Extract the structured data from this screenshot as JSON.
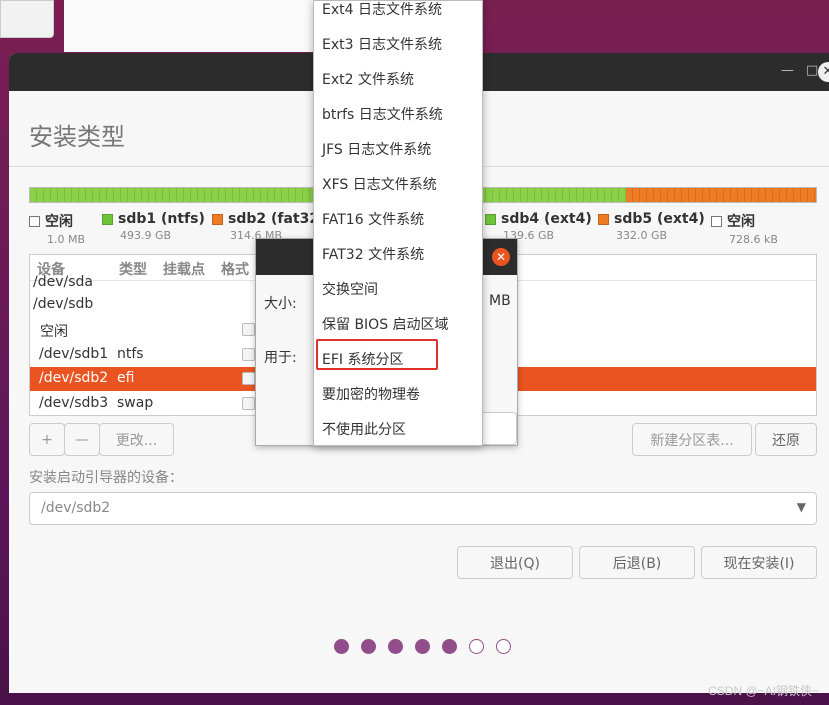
{
  "window": {
    "page_title": "安装类型",
    "minimize": "—",
    "maximize": "□",
    "close": "✕"
  },
  "partition_bar": {
    "segments": [
      {
        "name": "sdb1",
        "fraction": 0.357,
        "color": "green"
      },
      {
        "name": "sdb2",
        "fraction": 0.223,
        "color": "green"
      },
      {
        "name": "sdb3",
        "fraction": 0.08,
        "color": "green"
      },
      {
        "name": "sdb4",
        "fraction": 0.098,
        "color": "green"
      },
      {
        "name": "sdb5",
        "fraction": 0.242,
        "color": "orange"
      }
    ]
  },
  "legend": [
    {
      "name": "空闲",
      "size": "1.0 MB",
      "swatch": "white"
    },
    {
      "name": "sdb1 (ntfs)",
      "size": "493.9 GB",
      "swatch": "green"
    },
    {
      "name": "sdb2 (fat32)",
      "size": "314.6 MB",
      "swatch": "orange"
    },
    {
      "name": "sdb4 (ext4)",
      "size": "139.6 GB",
      "swatch": "green"
    },
    {
      "name": "sdb5 (ext4)",
      "size": "332.0 GB",
      "swatch": "orange"
    },
    {
      "name": "空闲",
      "size": "728.6 kB",
      "swatch": "white"
    }
  ],
  "table": {
    "headers": [
      "设备",
      "类型",
      "挂载点",
      "格式"
    ],
    "rows": [
      {
        "device": "/dev/sda",
        "type": "",
        "selected": false
      },
      {
        "device": "/dev/sdb",
        "type": "",
        "selected": false
      },
      {
        "device": "空闲",
        "type": "",
        "selected": false
      },
      {
        "device": "/dev/sdb1",
        "type": "ntfs",
        "selected": false
      },
      {
        "device": "/dev/sdb2",
        "type": "efi",
        "selected": true
      },
      {
        "device": "/dev/sdb3",
        "type": "swap",
        "selected": false
      }
    ]
  },
  "table_buttons": {
    "add": "+",
    "remove": "—",
    "change": "更改...",
    "new_table": "新建分区表...",
    "revert": "还原"
  },
  "bootloader": {
    "label": "安装启动引导器的设备：",
    "value": "/dev/sdb2",
    "arrow": "▼"
  },
  "nav_buttons": {
    "quit": "退出(Q)",
    "back": "后退(B)",
    "install": "现在安装(I)"
  },
  "progress_dots": {
    "filled": 5,
    "total": 7
  },
  "dialog": {
    "close": "✕",
    "size_label": "大小:",
    "size_unit": "MB",
    "use_label": "用于:"
  },
  "menu": {
    "items": [
      "Ext4 日志文件系统",
      "Ext3 日志文件系统",
      "Ext2 文件系统",
      "btrfs 日志文件系统",
      "JFS 日志文件系统",
      "XFS 日志文件系统",
      "FAT16 文件系统",
      "FAT32 文件系统",
      "交换空间",
      "保留 BIOS 启动区域",
      "EFI 系统分区",
      "要加密的物理卷",
      "不使用此分区"
    ],
    "highlighted_index": 10
  },
  "watermark": "CSDN @~AI钢铁侠~"
}
